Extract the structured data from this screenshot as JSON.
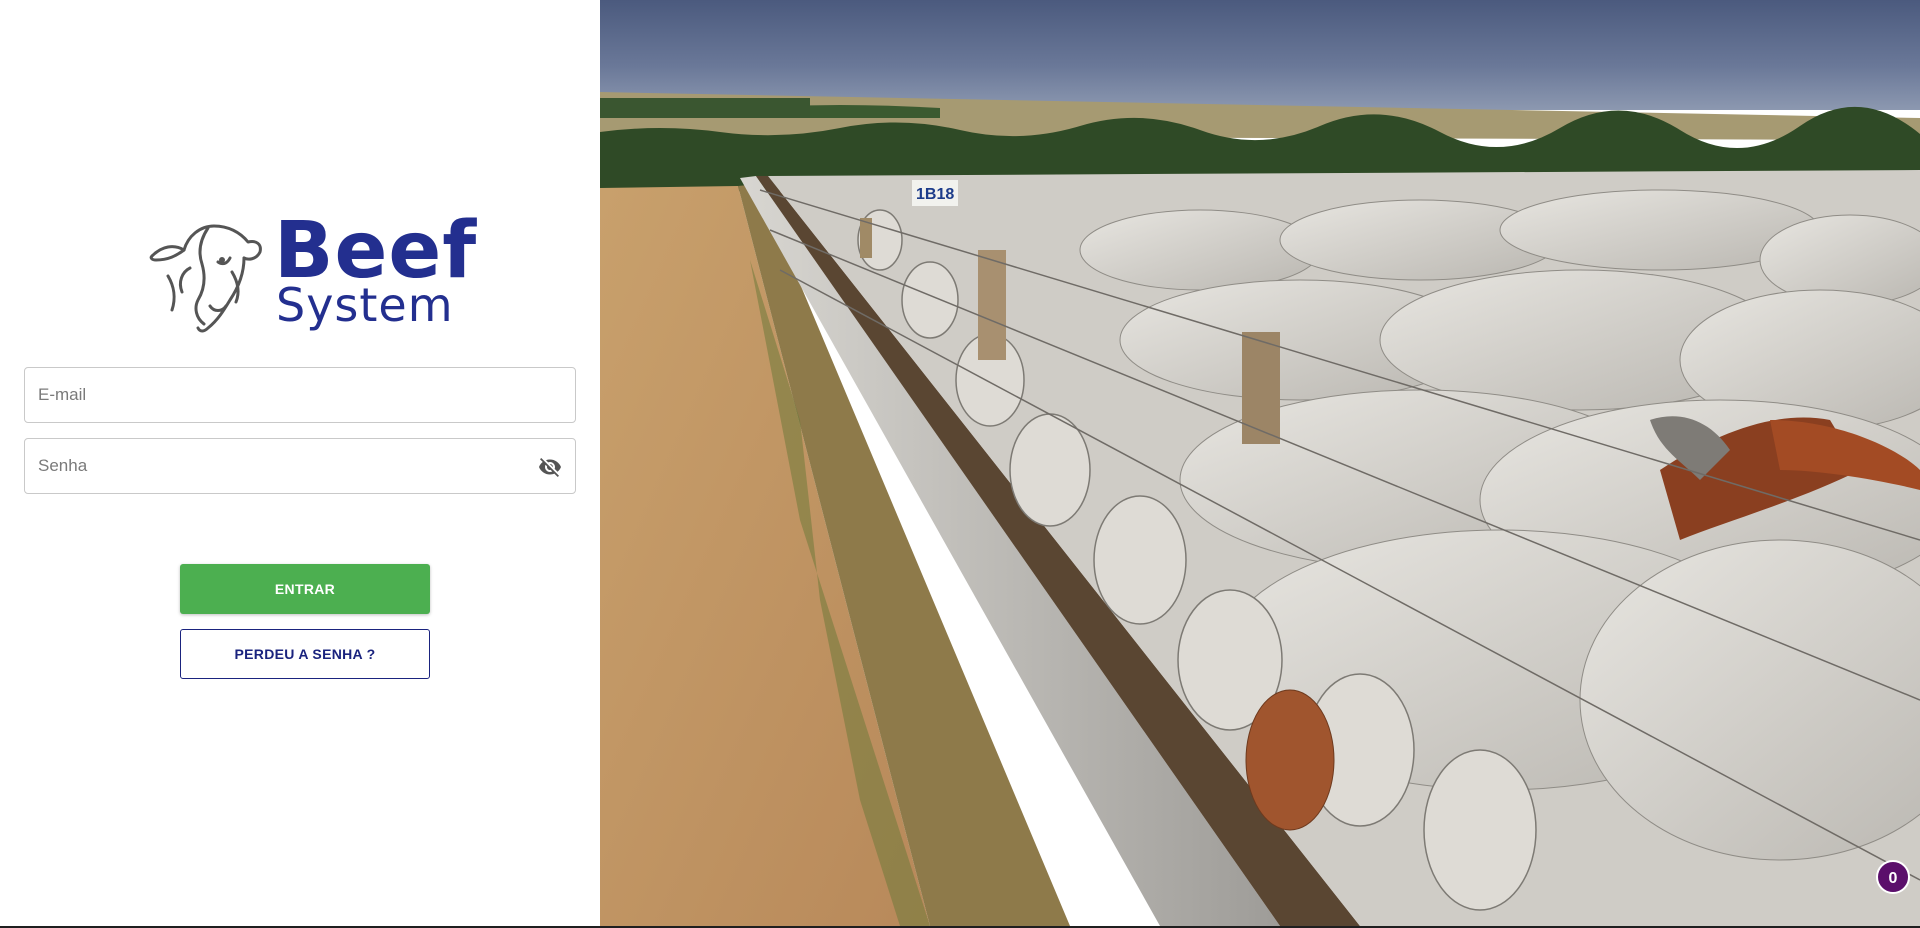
{
  "brand": {
    "word1": "Beef",
    "word2": "System",
    "color": "#232f8f",
    "icon": "bull-head-icon"
  },
  "login": {
    "email_placeholder": "E-mail",
    "password_placeholder": "Senha",
    "password_toggle_icon": "eye-off-icon",
    "submit_label": "ENTRAR",
    "forgot_label": "PERDEU A SENHA ?",
    "submit_color": "#4caf50",
    "forgot_color": "#1a237e"
  },
  "hero": {
    "description_icon": "cattle-feedlot-photo",
    "post_label": "1B18"
  },
  "notification": {
    "count": "0",
    "color": "#5b0f6b"
  }
}
